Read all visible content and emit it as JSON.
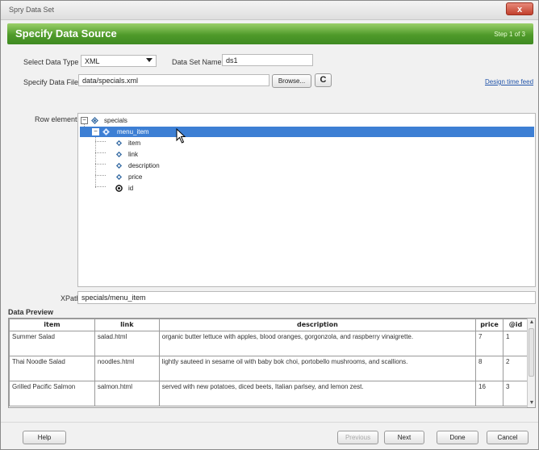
{
  "window": {
    "title": "Spry Data Set",
    "close_label": "x"
  },
  "header": {
    "title": "Specify Data Source",
    "step": "Step 1 of 3"
  },
  "form": {
    "data_type_label": "Select Data Type",
    "data_type_value": "XML",
    "dataset_name_label": "Data Set Name",
    "dataset_name_value": "ds1",
    "data_file_label": "Specify Data File",
    "data_file_value": "data/specials.xml",
    "browse_label": "Browse...",
    "refresh_label": "C",
    "design_feed_link": "Design time feed"
  },
  "tree": {
    "label": "Row element",
    "nodes": [
      {
        "label": "specials",
        "icon": "element-repeat-icon"
      },
      {
        "label": "menu_item",
        "icon": "element-repeat-icon"
      },
      {
        "label": "item",
        "icon": "element-icon"
      },
      {
        "label": "link",
        "icon": "element-icon"
      },
      {
        "label": "description",
        "icon": "element-icon"
      },
      {
        "label": "price",
        "icon": "element-icon"
      },
      {
        "label": "id",
        "icon": "attribute-icon"
      }
    ]
  },
  "xpath": {
    "label": "XPath",
    "value": "specials/menu_item"
  },
  "preview": {
    "title": "Data Preview",
    "columns": [
      "item",
      "link",
      "description",
      "price",
      "@id"
    ],
    "rows": [
      [
        "Summer Salad",
        "salad.html",
        "organic butter lettuce with apples, blood oranges, gorgonzola, and raspberry vinaigrette.",
        "7",
        "1"
      ],
      [
        "Thai Noodle Salad",
        "noodles.html",
        "lightly sauteed in sesame oil with baby bok choi, portobello mushrooms, and scallions.",
        "8",
        "2"
      ],
      [
        "Grilled Pacific Salmon",
        "salmon.html",
        "served with new potatoes, diced beets, Italian parlsey, and lemon zest.",
        "16",
        "3"
      ]
    ]
  },
  "footer": {
    "help": "Help",
    "previous": "Previous",
    "next": "Next",
    "done": "Done",
    "cancel": "Cancel"
  },
  "colors": {
    "header_green": "#4f9a2a",
    "selection_blue": "#3d7fd4",
    "link_blue": "#2255aa"
  }
}
